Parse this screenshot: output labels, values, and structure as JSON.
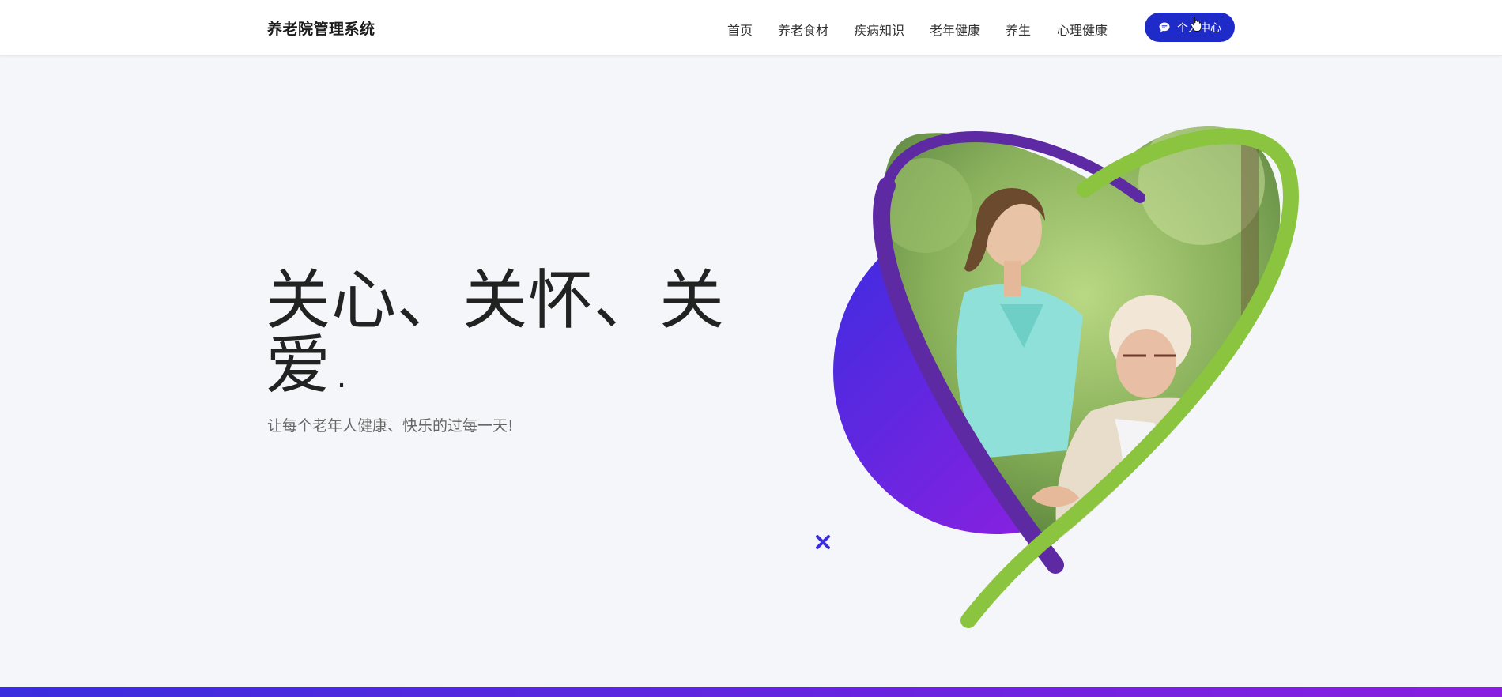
{
  "header": {
    "brand": "养老院管理系统",
    "nav": [
      {
        "label": "首页"
      },
      {
        "label": "养老食材"
      },
      {
        "label": "疾病知识"
      },
      {
        "label": "老年健康"
      },
      {
        "label": "养生"
      },
      {
        "label": "心理健康"
      }
    ],
    "user_center": {
      "label": "个人中心",
      "icon": "chat-icon",
      "color": "#1f2bc9"
    }
  },
  "hero": {
    "title_line1": "关心、关怀、关",
    "title_line2": "爱.",
    "subtitle": "让每个老年人健康、快乐的过每一天!",
    "image": "caregiver-with-elderly-woman-photo",
    "accent_colors": {
      "blue": "#3a2de0",
      "purple": "#9a1ee0",
      "green": "#8bc53f"
    }
  },
  "footer_bar": {
    "color_start": "#3a2de0",
    "color_end": "#8a1ee0"
  }
}
